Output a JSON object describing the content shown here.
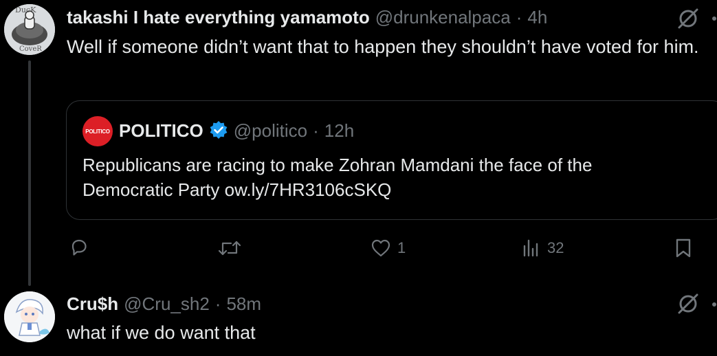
{
  "posts": [
    {
      "display_name": "takashi I hate everything yamamoto",
      "handle": "@drunkenalpaca",
      "separator": "·",
      "time": "4h",
      "text": "Well if someone didn’t want that to happen they shouldn’t have voted for him.",
      "avatar_text_top": "DucK",
      "avatar_text_bottom": "CoveR",
      "quote": {
        "logo_text": "POLITICO",
        "display_name": "POLITICO",
        "verified": true,
        "handle": "@politico",
        "separator": "·",
        "time": "12h",
        "text": "Republicans are racing to make Zohran Mamdani the face of the Democratic Party ow.ly/7HR3106cSKQ"
      },
      "actions": {
        "reply_count": "",
        "repost_count": "",
        "like_count": "1",
        "views_count": "32"
      }
    },
    {
      "display_name": "Cru$h",
      "handle": "@Cru_sh2",
      "separator": "·",
      "time": "58m",
      "text": "what if we do want that"
    }
  ],
  "icons": {
    "grok": "null-slash-icon",
    "reply": "reply-icon",
    "repost": "repost-icon",
    "like": "heart-icon",
    "views": "views-icon",
    "bookmark": "bookmark-icon",
    "verified": "verified-badge-icon"
  },
  "colors": {
    "background": "#000000",
    "text": "#e7e9ea",
    "muted": "#71767b",
    "border": "#2f3336",
    "verified": "#1d9bf0",
    "politico_red": "#dc1f26"
  }
}
